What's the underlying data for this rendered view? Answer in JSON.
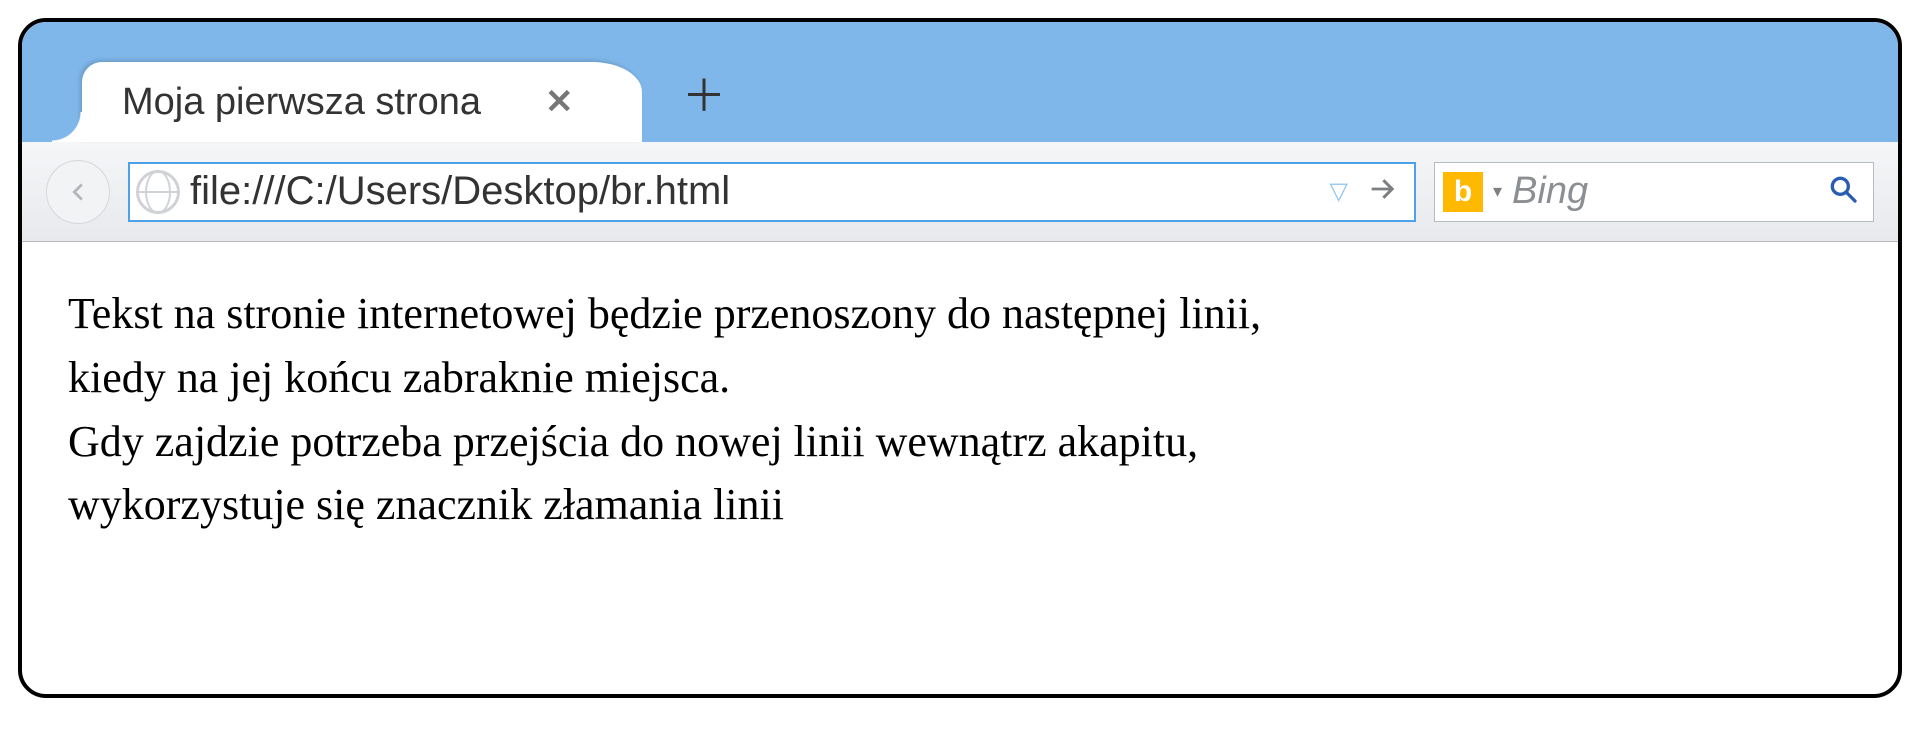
{
  "tab": {
    "title": "Moja pierwsza strona"
  },
  "url": "file:///C:/Users/Desktop/br.html",
  "search": {
    "placeholder": "Bing"
  },
  "page": {
    "line1": "Tekst na stronie internetowej będzie przenoszony do następnej linii,",
    "line2": "kiedy na jej końcu zabraknie miejsca.",
    "line3": "Gdy zajdzie potrzeba przejścia do nowej linii wewnątrz akapitu,",
    "line4": "wykorzystuje się znacznik złamania linii"
  }
}
